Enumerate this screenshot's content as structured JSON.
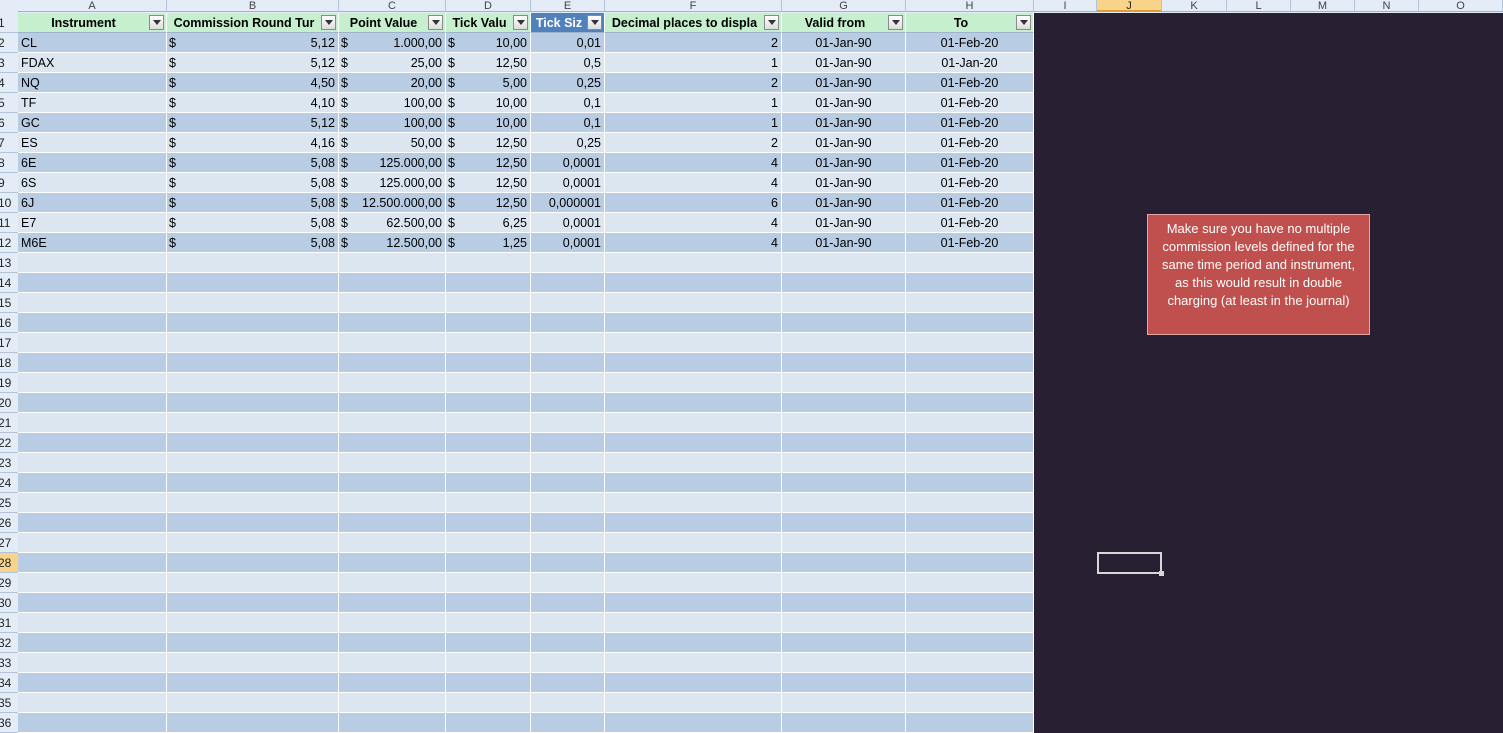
{
  "columns": [
    "A",
    "B",
    "C",
    "D",
    "E",
    "F",
    "G",
    "H",
    "I",
    "J",
    "K",
    "L",
    "M",
    "N",
    "O"
  ],
  "selected_column": "J",
  "selected_row": "28",
  "row_numbers": [
    "1",
    "2",
    "3",
    "4",
    "5",
    "6",
    "7",
    "8",
    "9",
    "10",
    "11",
    "12",
    "13",
    "14",
    "15",
    "16",
    "17",
    "18",
    "19",
    "20",
    "21",
    "22",
    "23",
    "24",
    "25",
    "26",
    "27",
    "28",
    "29",
    "30",
    "31",
    "32",
    "33",
    "34",
    "35",
    "36"
  ],
  "table": {
    "headers": [
      "Instrument",
      "Commission Round Tur",
      "Point Value",
      "Tick Valu",
      "Tick Siz",
      "Decimal places to displa",
      "Valid from",
      "To"
    ],
    "currency_symbol": "$",
    "rows": [
      [
        "CL",
        "5,12",
        "1.000,00",
        "10,00",
        "0,01",
        "2",
        "01-Jan-90",
        "01-Feb-20"
      ],
      [
        "FDAX",
        "5,12",
        "25,00",
        "12,50",
        "0,5",
        "1",
        "01-Jan-90",
        "01-Jan-20"
      ],
      [
        "NQ",
        "4,50",
        "20,00",
        "5,00",
        "0,25",
        "2",
        "01-Jan-90",
        "01-Feb-20"
      ],
      [
        "TF",
        "4,10",
        "100,00",
        "10,00",
        "0,1",
        "1",
        "01-Jan-90",
        "01-Feb-20"
      ],
      [
        "GC",
        "5,12",
        "100,00",
        "10,00",
        "0,1",
        "1",
        "01-Jan-90",
        "01-Feb-20"
      ],
      [
        "ES",
        "4,16",
        "50,00",
        "12,50",
        "0,25",
        "2",
        "01-Jan-90",
        "01-Feb-20"
      ],
      [
        "6E",
        "5,08",
        "125.000,00",
        "12,50",
        "0,0001",
        "4",
        "01-Jan-90",
        "01-Feb-20"
      ],
      [
        "6S",
        "5,08",
        "125.000,00",
        "12,50",
        "0,0001",
        "4",
        "01-Jan-90",
        "01-Feb-20"
      ],
      [
        "6J",
        "5,08",
        "12.500.000,00",
        "12,50",
        "0,000001",
        "6",
        "01-Jan-90",
        "01-Feb-20"
      ],
      [
        "E7",
        "5,08",
        "62.500,00",
        "6,25",
        "0,0001",
        "4",
        "01-Jan-90",
        "01-Feb-20"
      ],
      [
        "M6E",
        "5,08",
        "12.500,00",
        "1,25",
        "0,0001",
        "4",
        "01-Jan-90",
        "01-Feb-20"
      ]
    ]
  },
  "note": "Make sure you have no multiple commission levels defined for the same time period and instrument, as this would result in double charging (at least in the journal)",
  "colors": {
    "header_fill": "#c6efce",
    "band_dark": "#b8cce4",
    "band_light": "#dce6f1",
    "selected_header": "#4f81bd",
    "note_fill": "#c0504d",
    "sheet_background": "#281f32"
  }
}
